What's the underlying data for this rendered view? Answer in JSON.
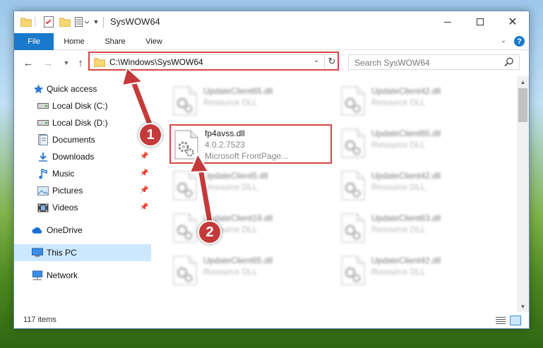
{
  "window": {
    "title": "SysWOW64"
  },
  "ribbon": {
    "tabs": [
      {
        "label": "File"
      },
      {
        "label": "Home"
      },
      {
        "label": "Share"
      },
      {
        "label": "View"
      }
    ],
    "help_label": "?"
  },
  "navigation": {
    "address": "C:\\Windows\\SysWOW64",
    "search_placeholder": "Search SysWOW64"
  },
  "sidebar": {
    "items": [
      {
        "label": "Quick access",
        "icon": "star-icon"
      },
      {
        "label": "Local Disk (C:)",
        "icon": "drive-icon"
      },
      {
        "label": "Local Disk (D:)",
        "icon": "drive-icon"
      },
      {
        "label": "Documents",
        "icon": "documents-icon",
        "pinned": true
      },
      {
        "label": "Downloads",
        "icon": "download-icon",
        "pinned": true
      },
      {
        "label": "Music",
        "icon": "music-icon",
        "pinned": true
      },
      {
        "label": "Pictures",
        "icon": "pictures-icon",
        "pinned": true
      },
      {
        "label": "Videos",
        "icon": "videos-icon",
        "pinned": true
      },
      {
        "label": "OneDrive",
        "icon": "cloud-icon"
      },
      {
        "label": "This PC",
        "icon": "computer-icon",
        "selected": true
      },
      {
        "label": "Network",
        "icon": "network-icon"
      }
    ]
  },
  "files": {
    "selected": {
      "name": "fp4avss.dll",
      "version": "4.0.2.7523",
      "description": "Microsoft FrontPage..."
    },
    "background": [
      {
        "name": "UpdateClient65.dll",
        "type": "Resource DLL"
      },
      {
        "name": "UpdateClient42.dll",
        "type": "Resource DLL"
      },
      {
        "name": "UpdateClient65.dll",
        "type": "Resource DLL"
      },
      {
        "name": "UpdateClient5.dll",
        "type": "Resource DLL"
      },
      {
        "name": "UpdateClient42.dll",
        "type": "Resource DLL"
      },
      {
        "name": "UpdateClient19.dll",
        "type": "Resource DLL"
      },
      {
        "name": "UpdateClient63.dll",
        "type": "Resource DLL"
      },
      {
        "name": "UpdateClient65.dll",
        "type": "Resource DLL"
      },
      {
        "name": "UpdateClient42.dll",
        "type": "Resource DLL"
      }
    ]
  },
  "status": {
    "item_count": "117 items"
  },
  "annotations": {
    "step1": "1",
    "step2": "2",
    "highlight_color": "#d94646",
    "marker_color": "#c43a3a"
  },
  "colors": {
    "accent": "#1979ca",
    "selection": "#cce8ff"
  }
}
